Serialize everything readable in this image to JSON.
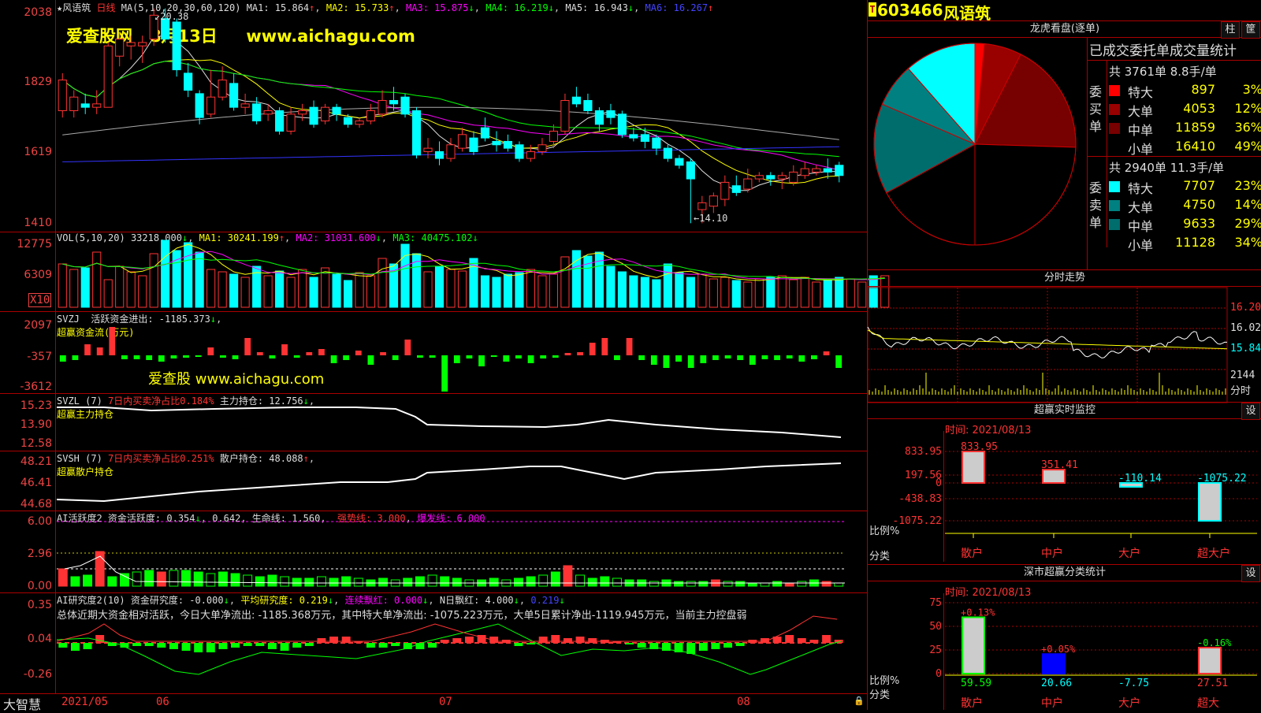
{
  "stock": {
    "code": "603466",
    "name": "风语筑",
    "t_badge": "T"
  },
  "watermark": {
    "site": "爱查股网",
    "date": "8月13日",
    "url": "www.aichagu.com",
    "mid_text": "爱查股 www.aichagu.com"
  },
  "footer": {
    "brand": "大智慧",
    "dates": [
      "2021/05",
      "06",
      "07",
      "08"
    ]
  },
  "colors": {
    "up": "#ff3333",
    "down": "#00ffff",
    "green": "#00ff00",
    "bg": "#000000",
    "grid": "#aa0000"
  },
  "kline": {
    "title": "风语筑",
    "period": "日线",
    "params": "MA(5,10,20,30,60,120)",
    "ma1": "MA1: 15.864",
    "ma2": "MA2: 15.733",
    "ma3": "MA3: 15.875",
    "ma4": "MA4: 16.219",
    "ma5": "MA5: 16.943",
    "ma6": "MA6: 16.267",
    "y_labels": [
      "2038",
      "1829",
      "1619",
      "1410"
    ],
    "hi_label": "20.38",
    "lo_label": "14.10",
    "candles": [
      {
        "o": 17.4,
        "c": 18.3,
        "h": 18.5,
        "l": 17.2
      },
      {
        "o": 17.4,
        "c": 17.8,
        "h": 18.0,
        "l": 17.2
      },
      {
        "o": 17.6,
        "c": 17.5,
        "h": 17.9,
        "l": 17.3
      },
      {
        "o": 17.5,
        "c": 17.6,
        "h": 18.0,
        "l": 17.3
      },
      {
        "o": 17.5,
        "c": 19.3,
        "h": 19.4,
        "l": 17.5
      },
      {
        "o": 19.0,
        "c": 19.5,
        "h": 19.7,
        "l": 18.7
      },
      {
        "o": 19.3,
        "c": 19.4,
        "h": 19.6,
        "l": 18.9
      },
      {
        "o": 19.3,
        "c": 19.4,
        "h": 19.6,
        "l": 18.8
      },
      {
        "o": 19.5,
        "c": 20.2,
        "h": 20.4,
        "l": 19.3
      },
      {
        "o": 20.1,
        "c": 19.5,
        "h": 20.4,
        "l": 19.4
      },
      {
        "o": 20.0,
        "c": 18.6,
        "h": 20.1,
        "l": 18.4
      },
      {
        "o": 18.5,
        "c": 18.0,
        "h": 18.8,
        "l": 17.8
      },
      {
        "o": 17.9,
        "c": 17.2,
        "h": 18.0,
        "l": 17.0
      },
      {
        "o": 17.3,
        "c": 17.8,
        "h": 18.6,
        "l": 17.2
      },
      {
        "o": 17.8,
        "c": 18.3,
        "h": 18.7,
        "l": 17.7
      },
      {
        "o": 18.2,
        "c": 17.5,
        "h": 18.5,
        "l": 17.4
      },
      {
        "o": 17.5,
        "c": 17.6,
        "h": 17.9,
        "l": 17.3
      },
      {
        "o": 17.6,
        "c": 17.1,
        "h": 17.8,
        "l": 17.0
      },
      {
        "o": 17.3,
        "c": 17.4,
        "h": 17.6,
        "l": 17.1
      },
      {
        "o": 17.4,
        "c": 16.8,
        "h": 17.5,
        "l": 16.7
      },
      {
        "o": 16.8,
        "c": 17.3,
        "h": 17.5,
        "l": 16.7
      },
      {
        "o": 17.3,
        "c": 17.4,
        "h": 17.6,
        "l": 17.1
      },
      {
        "o": 17.5,
        "c": 17.0,
        "h": 17.7,
        "l": 16.9
      },
      {
        "o": 17.1,
        "c": 17.5,
        "h": 17.6,
        "l": 17.0
      },
      {
        "o": 17.5,
        "c": 17.3,
        "h": 17.6,
        "l": 17.1
      },
      {
        "o": 17.2,
        "c": 17.0,
        "h": 17.3,
        "l": 16.9
      },
      {
        "o": 17.0,
        "c": 17.1,
        "h": 17.2,
        "l": 16.9
      },
      {
        "o": 17.1,
        "c": 17.4,
        "h": 17.6,
        "l": 17.0
      },
      {
        "o": 17.3,
        "c": 17.7,
        "h": 18.0,
        "l": 17.2
      },
      {
        "o": 17.7,
        "c": 17.6,
        "h": 18.1,
        "l": 17.4
      },
      {
        "o": 17.8,
        "c": 17.3,
        "h": 17.9,
        "l": 17.2
      },
      {
        "o": 17.4,
        "c": 16.1,
        "h": 17.5,
        "l": 16.0
      },
      {
        "o": 16.2,
        "c": 16.3,
        "h": 16.6,
        "l": 16.0
      },
      {
        "o": 16.2,
        "c": 16.0,
        "h": 16.5,
        "l": 15.8
      },
      {
        "o": 16.0,
        "c": 16.4,
        "h": 16.6,
        "l": 15.9
      },
      {
        "o": 16.3,
        "c": 16.7,
        "h": 16.9,
        "l": 16.2
      },
      {
        "o": 16.6,
        "c": 16.2,
        "h": 16.8,
        "l": 16.1
      },
      {
        "o": 16.9,
        "c": 16.6,
        "h": 17.2,
        "l": 16.5
      },
      {
        "o": 16.5,
        "c": 16.4,
        "h": 16.8,
        "l": 16.2
      },
      {
        "o": 16.5,
        "c": 16.3,
        "h": 16.7,
        "l": 16.2
      },
      {
        "o": 16.4,
        "c": 16.0,
        "h": 16.5,
        "l": 15.9
      },
      {
        "o": 16.0,
        "c": 16.2,
        "h": 16.4,
        "l": 15.9
      },
      {
        "o": 16.2,
        "c": 16.4,
        "h": 16.6,
        "l": 16.1
      },
      {
        "o": 16.5,
        "c": 16.8,
        "h": 17.0,
        "l": 16.3
      },
      {
        "o": 16.8,
        "c": 17.7,
        "h": 17.9,
        "l": 16.7
      },
      {
        "o": 17.8,
        "c": 17.6,
        "h": 18.1,
        "l": 17.5
      },
      {
        "o": 17.7,
        "c": 17.4,
        "h": 17.9,
        "l": 17.3
      },
      {
        "o": 17.4,
        "c": 17.0,
        "h": 17.5,
        "l": 16.8
      },
      {
        "o": 17.4,
        "c": 17.2,
        "h": 17.6,
        "l": 17.0
      },
      {
        "o": 17.3,
        "c": 16.7,
        "h": 17.4,
        "l": 16.6
      },
      {
        "o": 16.7,
        "c": 16.6,
        "h": 16.9,
        "l": 16.5
      },
      {
        "o": 16.7,
        "c": 16.5,
        "h": 16.9,
        "l": 16.3
      },
      {
        "o": 16.6,
        "c": 16.3,
        "h": 16.7,
        "l": 16.1
      },
      {
        "o": 16.3,
        "c": 16.0,
        "h": 16.4,
        "l": 15.9
      },
      {
        "o": 16.0,
        "c": 15.8,
        "h": 16.1,
        "l": 15.7
      },
      {
        "o": 15.9,
        "c": 15.4,
        "h": 16.0,
        "l": 14.1
      },
      {
        "o": 14.5,
        "c": 14.7,
        "h": 14.9,
        "l": 14.1
      },
      {
        "o": 14.6,
        "c": 14.9,
        "h": 15.0,
        "l": 14.4
      },
      {
        "o": 14.8,
        "c": 15.3,
        "h": 15.5,
        "l": 14.6
      },
      {
        "o": 15.2,
        "c": 15.0,
        "h": 15.5,
        "l": 14.9
      },
      {
        "o": 15.1,
        "c": 15.4,
        "h": 15.7,
        "l": 15.0
      },
      {
        "o": 15.4,
        "c": 15.5,
        "h": 15.6,
        "l": 15.3
      },
      {
        "o": 15.5,
        "c": 15.4,
        "h": 15.6,
        "l": 15.2
      },
      {
        "o": 15.4,
        "c": 15.5,
        "h": 15.6,
        "l": 15.1
      },
      {
        "o": 15.3,
        "c": 15.6,
        "h": 15.8,
        "l": 15.2
      },
      {
        "o": 15.5,
        "c": 15.7,
        "h": 15.9,
        "l": 15.4
      },
      {
        "o": 15.6,
        "c": 15.7,
        "h": 15.8,
        "l": 15.5
      },
      {
        "o": 15.7,
        "c": 15.6,
        "h": 16.0,
        "l": 15.4
      },
      {
        "o": 15.8,
        "c": 15.5,
        "h": 15.9,
        "l": 15.3
      }
    ]
  },
  "vol": {
    "header": "VOL(5,10,20)",
    "value": "33218.000",
    "ma1": "MA1: 30241.199",
    "ma2": "MA2: 31031.600",
    "ma3": "MA3: 40475.102",
    "y_labels": [
      "12775",
      "6309"
    ],
    "unit": "X10"
  },
  "svzj": {
    "header": "SVZJ",
    "label": "活跃资金进出: -1185.373",
    "sub": "超赢资金流(万元)",
    "y_labels": [
      "2097",
      "-357",
      "-3612"
    ]
  },
  "svzl": {
    "header": "SVZL (7)",
    "red": "7日内买卖净占比0.184%",
    "label": "主力持仓: 12.756",
    "sub": "超赢主力持仓",
    "y_labels": [
      "15.23",
      "13.90",
      "12.58"
    ]
  },
  "svsh": {
    "header": "SVSH (7)",
    "red": "7日内买卖净占比0.251%",
    "label": "散户持仓: 48.088",
    "sub": "超赢散户持仓",
    "y_labels": [
      "48.21",
      "46.41",
      "44.68"
    ]
  },
  "ai1": {
    "header": "AI活跃度2",
    "a": "资金活跃度: 0.354",
    "b": "0.642",
    "c": "生命线: 1.560",
    "d": "强势线: 3.000",
    "e": "爆发线: 6.000",
    "y_labels": [
      "6.00",
      "2.96",
      "0.00"
    ]
  },
  "ai2": {
    "header": "AI研究度2(10)",
    "a": "资金研究度: -0.000",
    "b": "平均研究度: 0.219",
    "c": "连续飘红: 0.000",
    "d": "N日飘红: 4.000",
    "e": "0.219",
    "summary": "总体近期大资金相对活跃，今日大单净流出: -1185.368万元，其中特大单净流出: -1075.223万元，大单5日累计净出-1119.945万元，当前主力控盘弱",
    "y_labels": [
      "0.35",
      "0.04",
      "-0.26"
    ]
  },
  "lhb": {
    "title": "龙虎看盘(逐单)",
    "btn_a": "柱",
    "btn_b": "筐",
    "subtitle": "已成交委托单成交量统计",
    "buy_side": "委买单",
    "sell_side": "委卖单",
    "buy_total": "共 3761单 8.8手/单",
    "buy_rows": [
      {
        "label": "特大",
        "qty": "897",
        "pct": "3%",
        "color": "#ff0000"
      },
      {
        "label": "大单",
        "qty": "4053",
        "pct": "12%",
        "color": "#990000"
      },
      {
        "label": "中单",
        "qty": "11859",
        "pct": "36%",
        "color": "#770000"
      },
      {
        "label": "小单",
        "qty": "16410",
        "pct": "49%",
        "color": "#000000"
      }
    ],
    "sell_total": "共 2940单 11.3手/单",
    "sell_rows": [
      {
        "label": "特大",
        "qty": "7707",
        "pct": "23%",
        "color": "#00ffff"
      },
      {
        "label": "大单",
        "qty": "4750",
        "pct": "14%",
        "color": "#008080"
      },
      {
        "label": "中单",
        "qty": "9633",
        "pct": "29%",
        "color": "#006d6d"
      },
      {
        "label": "小单",
        "qty": "11128",
        "pct": "34%",
        "color": "#000000"
      }
    ]
  },
  "fenshi": {
    "title": "分时走势",
    "y_labels": [
      "16.20",
      "16.02",
      "15.84"
    ],
    "vol_label": "2144",
    "vol_unit": "分时"
  },
  "monitor": {
    "title": "超赢实时监控",
    "btn": "设",
    "time": "时间: 2021/08/13",
    "y_labels": [
      "833.95",
      "197.56",
      "0",
      "-438.83",
      "-1075.22"
    ],
    "left_labels": [
      "比例%",
      "分类"
    ],
    "bars": [
      {
        "cat": "散户",
        "value": 833.95,
        "label": "833.95"
      },
      {
        "cat": "中户",
        "value": 351.41,
        "label": "351.41"
      },
      {
        "cat": "大户",
        "value": -110.14,
        "label": "-110.14"
      },
      {
        "cat": "超大户",
        "value": -1075.22,
        "label": "-1075.22"
      }
    ]
  },
  "szstat": {
    "title": "深市超赢分类统计",
    "btn": "设",
    "time": "时间: 2021/08/13",
    "y_labels": [
      "75",
      "50",
      "25",
      "0"
    ],
    "left_labels": [
      "比例%",
      "分类"
    ],
    "bars": [
      {
        "cat": "散户",
        "value": 59.59,
        "pct": "+0.13%",
        "label": "59.59"
      },
      {
        "cat": "中户",
        "value": 20.66,
        "pct": "+0.05%",
        "label": "20.66"
      },
      {
        "cat": "大户",
        "value": -7.75,
        "pct": "",
        "label": "-7.75"
      },
      {
        "cat": "超大",
        "value": 27.51,
        "pct": "-0.16%",
        "label": "27.51"
      }
    ]
  }
}
